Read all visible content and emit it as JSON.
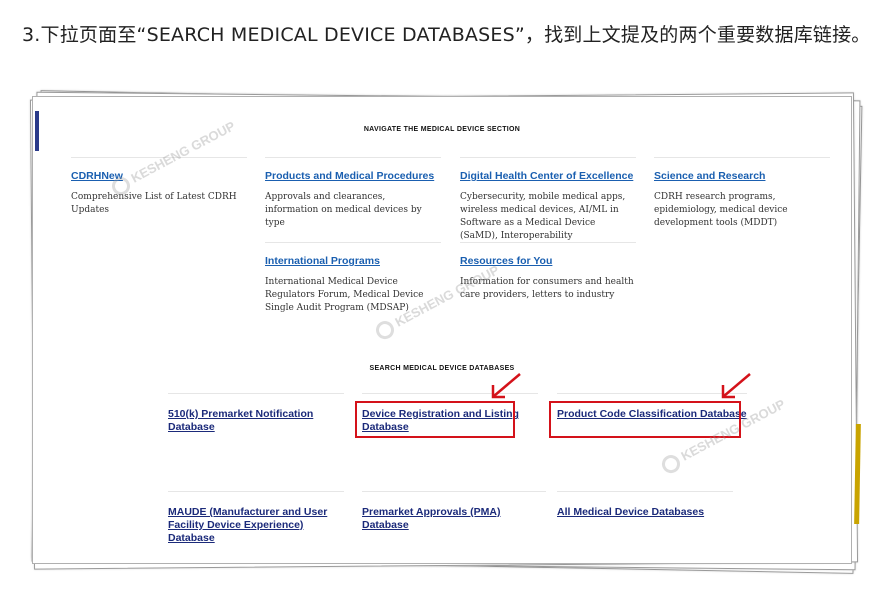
{
  "intro_text": "3.下拉页面至“SEARCH MEDICAL DEVICE DATABASES”，找到上文提及的两个重要数据库链接。",
  "navigate": {
    "heading": "NAVIGATE THE MEDICAL DEVICE SECTION",
    "cards": [
      {
        "title": "CDRHNew",
        "desc": "Comprehensive List of Latest CDRH Updates"
      },
      {
        "title": "Products and Medical Procedures",
        "desc": "Approvals and clearances, information on medical devices by type"
      },
      {
        "title": "Digital Health Center of Excellence",
        "desc": "Cybersecurity, mobile medical apps, wireless medical devices, AI/ML in Software as a Medical Device (SaMD), Interoperability"
      },
      {
        "title": "Science and Research",
        "desc": "CDRH research programs, epidemiology, medical device development tools (MDDT)"
      },
      {
        "title": "International Programs",
        "desc": "International Medical Device Regulators Forum, Medical Device Single Audit Program (MDSAP)"
      },
      {
        "title": "Resources for You",
        "desc": "Information for consumers and health care providers, letters to industry"
      }
    ]
  },
  "search": {
    "heading": "SEARCH MEDICAL DEVICE DATABASES",
    "databases": [
      {
        "title": "510(k) Premarket Notification Database"
      },
      {
        "title": "Device Registration and Listing Database"
      },
      {
        "title": "Product Code Classification Database"
      },
      {
        "title": "MAUDE (Manufacturer and User Facility Device Experience) Database"
      },
      {
        "title": "Premarket Approvals (PMA) Database"
      },
      {
        "title": "All Medical Device Databases"
      }
    ]
  },
  "colors": {
    "highlight": "#d4121a",
    "nav_link": "#1a5fb0",
    "db_link": "#1b2a7a"
  },
  "watermark": "KESHENG GROUP"
}
